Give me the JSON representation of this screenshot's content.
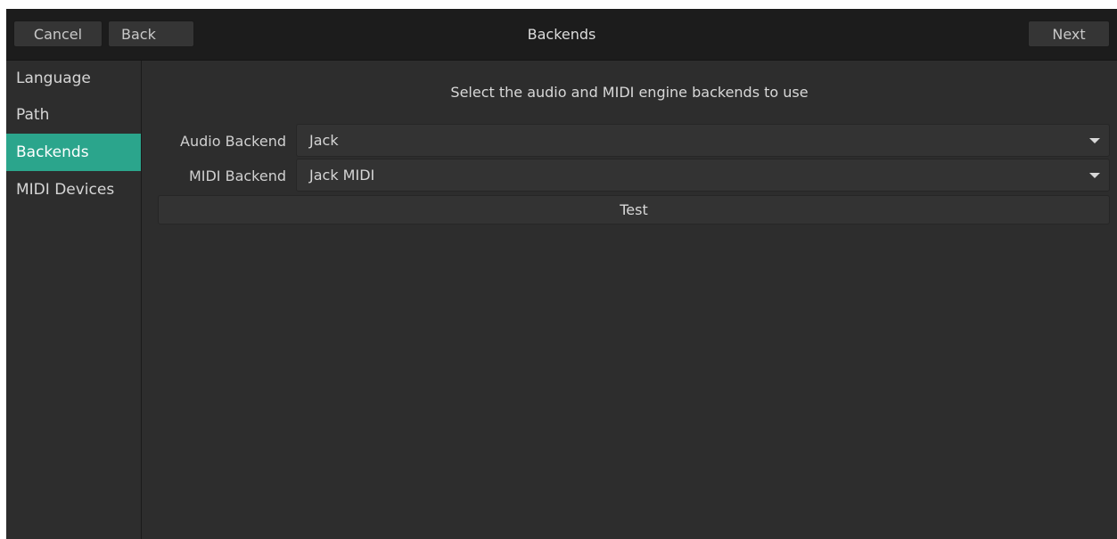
{
  "header": {
    "title": "Backends",
    "cancel_label": "Cancel",
    "back_label": "Back",
    "next_label": "Next"
  },
  "sidebar": {
    "items": [
      {
        "label": "Language",
        "active": false
      },
      {
        "label": "Path",
        "active": false
      },
      {
        "label": "Backends",
        "active": true
      },
      {
        "label": "MIDI Devices",
        "active": false
      }
    ]
  },
  "main": {
    "instructions": "Select the audio and MIDI engine backends to use",
    "audio_backend": {
      "label": "Audio Backend",
      "value": "Jack"
    },
    "midi_backend": {
      "label": "MIDI Backend",
      "value": "Jack MIDI"
    },
    "test_label": "Test"
  },
  "colors": {
    "accent": "#2ba58c",
    "header_bg": "#1c1c1c",
    "window_bg": "#2d2d2d"
  },
  "icons": {
    "dropdown": "chevron-down-icon"
  }
}
